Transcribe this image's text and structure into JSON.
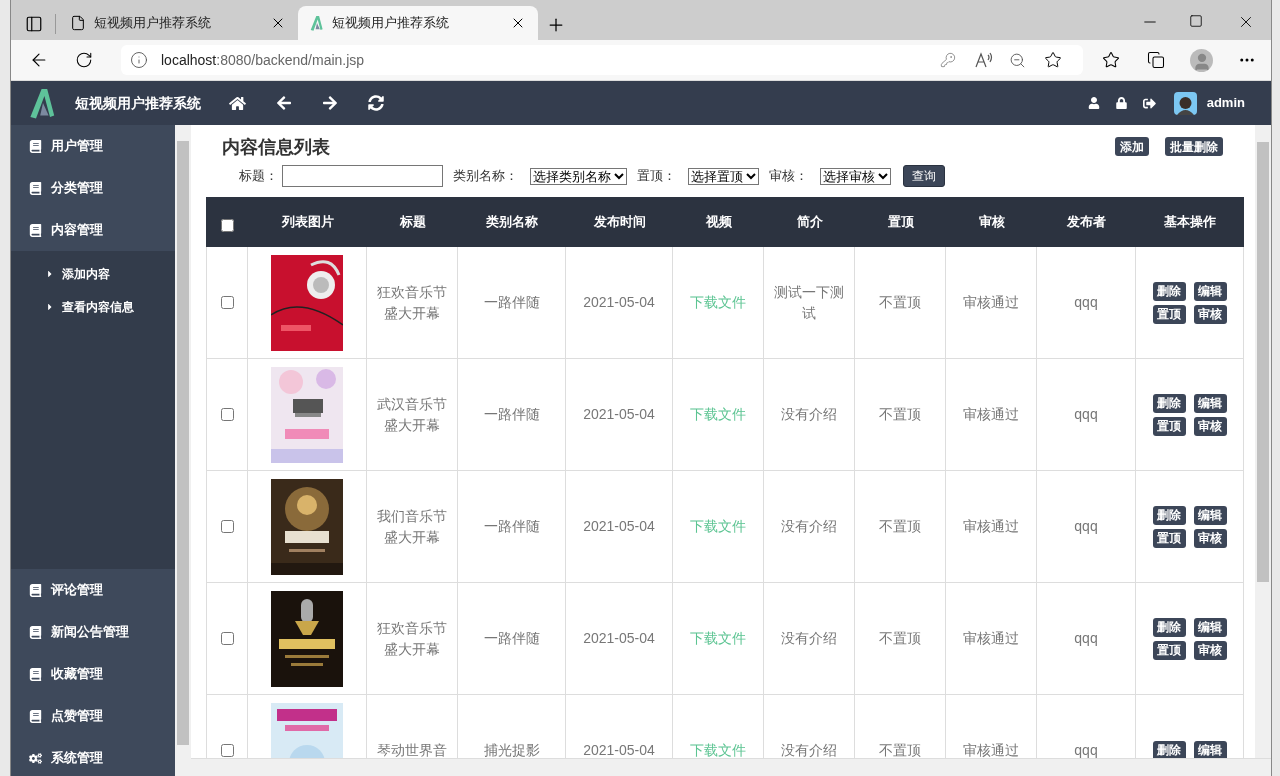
{
  "browser": {
    "tabs": [
      {
        "title": "短视频用户推荐系统",
        "selected": false,
        "kind": "page"
      },
      {
        "title": "短视频用户推荐系统",
        "selected": true,
        "kind": "logo"
      }
    ],
    "address": {
      "host": "localhost",
      "path": ":8080/backend/main.jsp"
    }
  },
  "header": {
    "title": "短视频用户推荐系统",
    "user": "admin"
  },
  "sidebar": {
    "items": [
      {
        "label": "用户管理",
        "kind": "book"
      },
      {
        "label": "分类管理",
        "kind": "book"
      },
      {
        "label": "内容管理",
        "kind": "book",
        "children": [
          {
            "label": "添加内容"
          },
          {
            "label": "查看内容信息"
          }
        ]
      },
      {
        "label": "评论管理",
        "kind": "book"
      },
      {
        "label": "新闻公告管理",
        "kind": "book"
      },
      {
        "label": "收藏管理",
        "kind": "book"
      },
      {
        "label": "点赞管理",
        "kind": "book"
      },
      {
        "label": "系统管理",
        "kind": "gears"
      }
    ]
  },
  "page": {
    "title": "内容信息列表",
    "actions": [
      "添加",
      "批量删除"
    ],
    "filters": [
      {
        "kind": "text",
        "label": "标题："
      },
      {
        "kind": "select",
        "label": "类别名称：",
        "value": "选择类别名称"
      },
      {
        "kind": "select",
        "label": "置顶：",
        "value": "选择置顶"
      },
      {
        "kind": "select",
        "label": "审核：",
        "value": "选择审核"
      }
    ],
    "query": "查询"
  },
  "table": {
    "header_checked": false,
    "columns": [
      "列表图片",
      "标题",
      "类别名称",
      "发布时间",
      "视频",
      "简介",
      "置顶",
      "审核",
      "发布者",
      "基本操作"
    ],
    "rows": [
      {
        "checked": false,
        "picture": {
          "kind": "picture"
        },
        "title": "狂欢音乐节盛大开幕",
        "category": "一路伴随",
        "date": "2021-05-04",
        "video": "下载文件",
        "intro": "测试一下测试",
        "top": "不置顶",
        "audit": "审核通过",
        "publisher": "qqq",
        "actions": [
          "删除",
          "编辑",
          "置顶",
          "审核"
        ]
      },
      {
        "checked": false,
        "picture": {
          "kind": "picture"
        },
        "title": "武汉音乐节盛大开幕",
        "category": "一路伴随",
        "date": "2021-05-04",
        "video": "下载文件",
        "intro": "没有介绍",
        "top": "不置顶",
        "audit": "审核通过",
        "publisher": "qqq",
        "actions": [
          "删除",
          "编辑",
          "置顶",
          "审核"
        ]
      },
      {
        "checked": false,
        "picture": {
          "kind": "picture"
        },
        "title": "我们音乐节盛大开幕",
        "category": "一路伴随",
        "date": "2021-05-04",
        "video": "下载文件",
        "intro": "没有介绍",
        "top": "不置顶",
        "audit": "审核通过",
        "publisher": "qqq",
        "actions": [
          "删除",
          "编辑",
          "置顶",
          "审核"
        ]
      },
      {
        "checked": false,
        "picture": {
          "kind": "picture"
        },
        "title": "狂欢音乐节盛大开幕",
        "category": "一路伴随",
        "date": "2021-05-04",
        "video": "下载文件",
        "intro": "没有介绍",
        "top": "不置顶",
        "audit": "审核通过",
        "publisher": "qqq",
        "actions": [
          "删除",
          "编辑",
          "置顶",
          "审核"
        ]
      },
      {
        "checked": false,
        "picture": {
          "kind": "picture"
        },
        "title": "琴动世界音",
        "category": "捕光捉影",
        "date": "2021-05-04",
        "video": "下载文件",
        "intro": "没有介绍",
        "top": "不置顶",
        "audit": "审核通过",
        "publisher": "qqq",
        "actions": [
          "删除",
          "编辑"
        ]
      }
    ]
  }
}
